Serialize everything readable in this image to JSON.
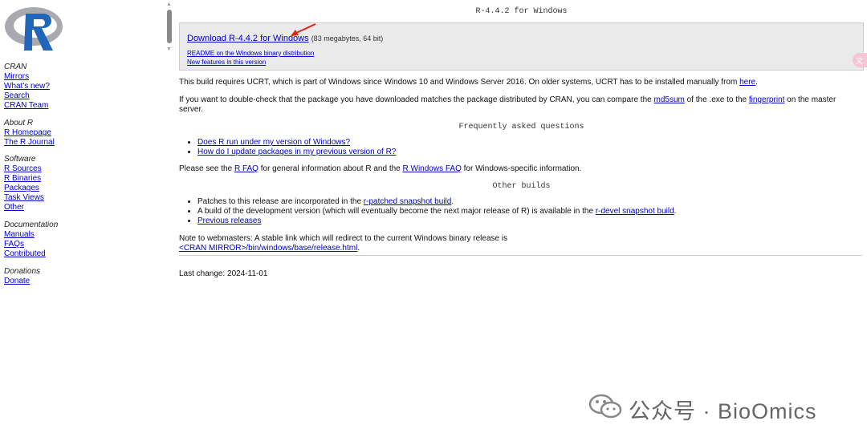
{
  "sidebar": {
    "logo_alt": "R",
    "sections": [
      {
        "heading": "CRAN",
        "links": [
          "Mirrors",
          "What's new?",
          "Search",
          "CRAN Team"
        ]
      },
      {
        "heading": "About R",
        "links": [
          "R Homepage",
          "The R Journal"
        ]
      },
      {
        "heading": "Software",
        "links": [
          "R Sources",
          "R Binaries",
          "Packages",
          "Task Views",
          "Other"
        ]
      },
      {
        "heading": "Documentation",
        "links": [
          "Manuals",
          "FAQs",
          "Contributed"
        ]
      },
      {
        "heading": "Donations",
        "links": [
          "Donate"
        ]
      }
    ]
  },
  "main": {
    "title": "R-4.4.2 for Windows",
    "download": {
      "link": "Download R-4.4.2 for Windows",
      "size": "(83 megabytes, 64 bit)",
      "readme": "README on the Windows binary distribution",
      "news": "New features in this version"
    },
    "ucrt": {
      "text": "This build requires UCRT, which is part of Windows since Windows 10 and Windows Server 2016. On older systems, UCRT has to be installed manually from ",
      "link": "here",
      "end": "."
    },
    "check": {
      "t1": "If you want to double-check that the package you have downloaded matches the package distributed by CRAN, you can compare the ",
      "md5": "md5sum",
      "t2": " of the .exe to the ",
      "fp": "fingerprint",
      "t3": " on the master server."
    },
    "faq_heading": "Frequently asked questions",
    "faq_items": [
      "Does R run under my version of Windows?",
      "How do I update packages in my previous version of R?"
    ],
    "rfaq": {
      "t1": "Please see the ",
      "l1": "R FAQ",
      "t2": " for general information about R and the ",
      "l2": "R Windows FAQ",
      "t3": " for Windows-specific information."
    },
    "other_heading": "Other builds",
    "other": {
      "p1": "Patches to this release are incorporated in the ",
      "p1_link": "r-patched snapshot build",
      "p1_end": ".",
      "p2": "A build of the development version (which will eventually become the next major release of R) is available in the ",
      "p2_link": "r-devel snapshot build",
      "p2_end": ".",
      "p3_link": "Previous releases"
    },
    "webmaster": {
      "text": "Note to webmasters: A stable link which will redirect to the current Windows binary release is",
      "link": "<CRAN MIRROR>/bin/windows/base/release.html",
      "end": "."
    },
    "last_change": "Last change: 2024-11-01"
  },
  "translate_icon": "translate-icon",
  "watermark": "公众号 · BioOmics",
  "colors": {
    "link": "#0000cc",
    "box": "#eaeaea",
    "arrow": "#e0241b"
  }
}
